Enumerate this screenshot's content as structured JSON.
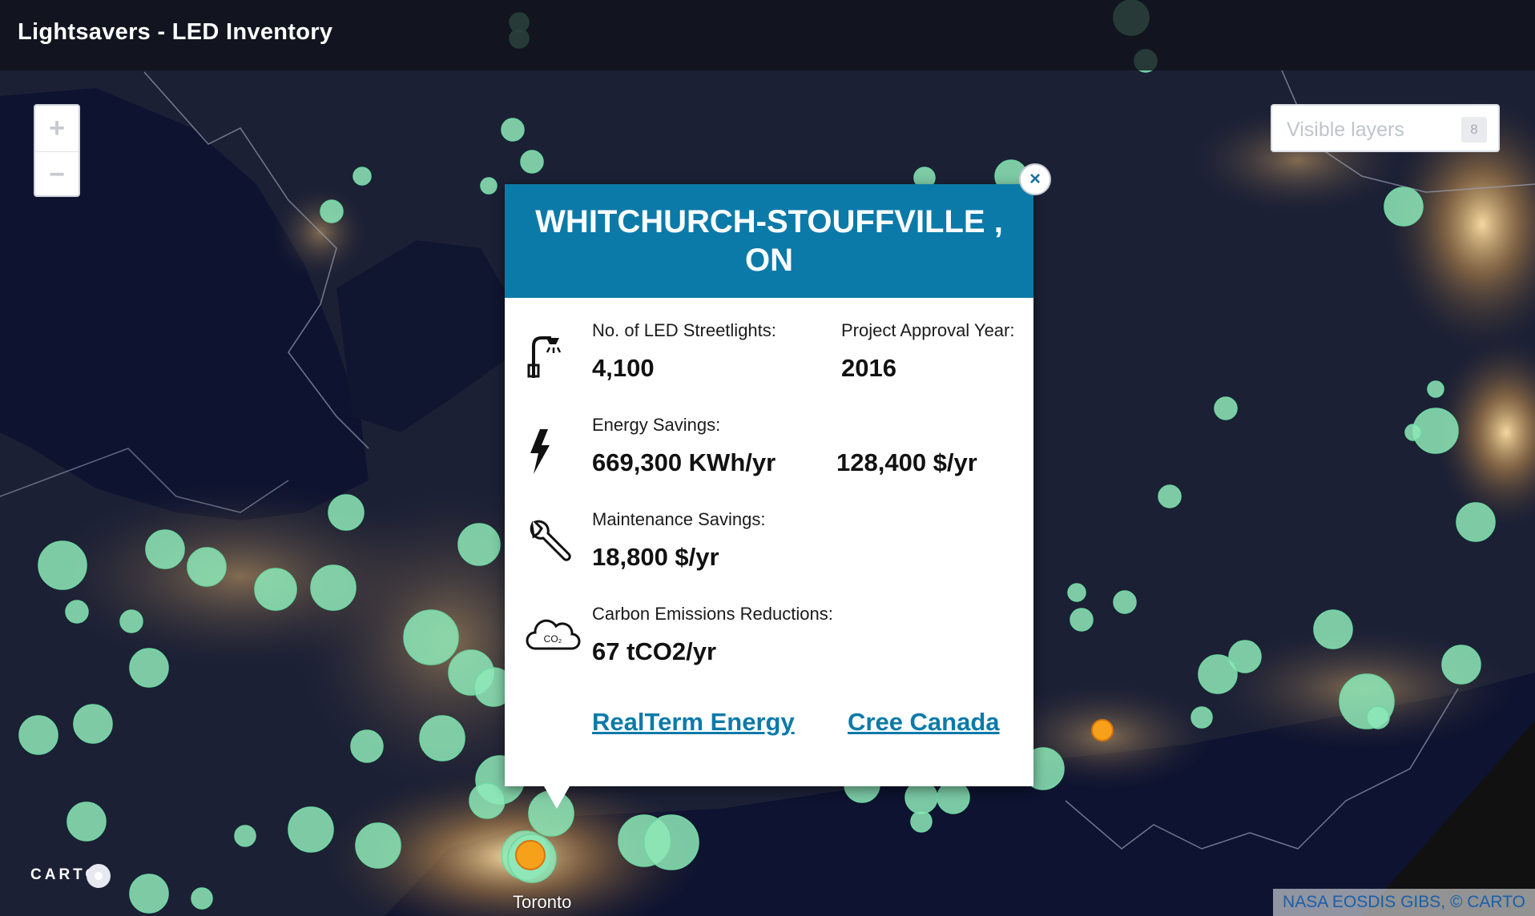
{
  "app": {
    "title": "Lightsavers - LED Inventory"
  },
  "zoom": {
    "in_label": "+",
    "out_label": "−"
  },
  "layers": {
    "label": "Visible layers",
    "count": "8"
  },
  "popup": {
    "title": "WHITCHURCH-STOUFFVILLE , ON",
    "close_label": "×",
    "rows": {
      "streetlights": {
        "label": "No. of LED Streetlights:",
        "value": "4,100",
        "icon": "streetlight-icon"
      },
      "approval": {
        "label": "Project Approval Year:",
        "value": "2016"
      },
      "energy": {
        "label": "Energy Savings:",
        "value_kwh": "669,300 KWh/yr",
        "value_dollars": "128,400 $/yr",
        "icon": "lightning-icon"
      },
      "maintenance": {
        "label": "Maintenance Savings:",
        "value": "18,800 $/yr",
        "icon": "wrench-icon"
      },
      "carbon": {
        "label": "Carbon Emissions Reductions:",
        "value": "67 tCO2/yr",
        "icon": "co2-cloud-icon",
        "icon_text": "CO₂"
      }
    },
    "links": {
      "primary": "RealTerm Energy",
      "secondary": "Cree Canada"
    }
  },
  "map": {
    "city_label": "Toronto",
    "marker_color_default": "#8ee9b9",
    "marker_color_selected": "#f7a11a"
  },
  "footer": {
    "carto_logo": "CARTO",
    "attribution": "NASA EOSDIS GIBS, © CARTO"
  },
  "colors": {
    "header_blue": "#0b7aa9",
    "link_blue": "#0b7aa9"
  }
}
